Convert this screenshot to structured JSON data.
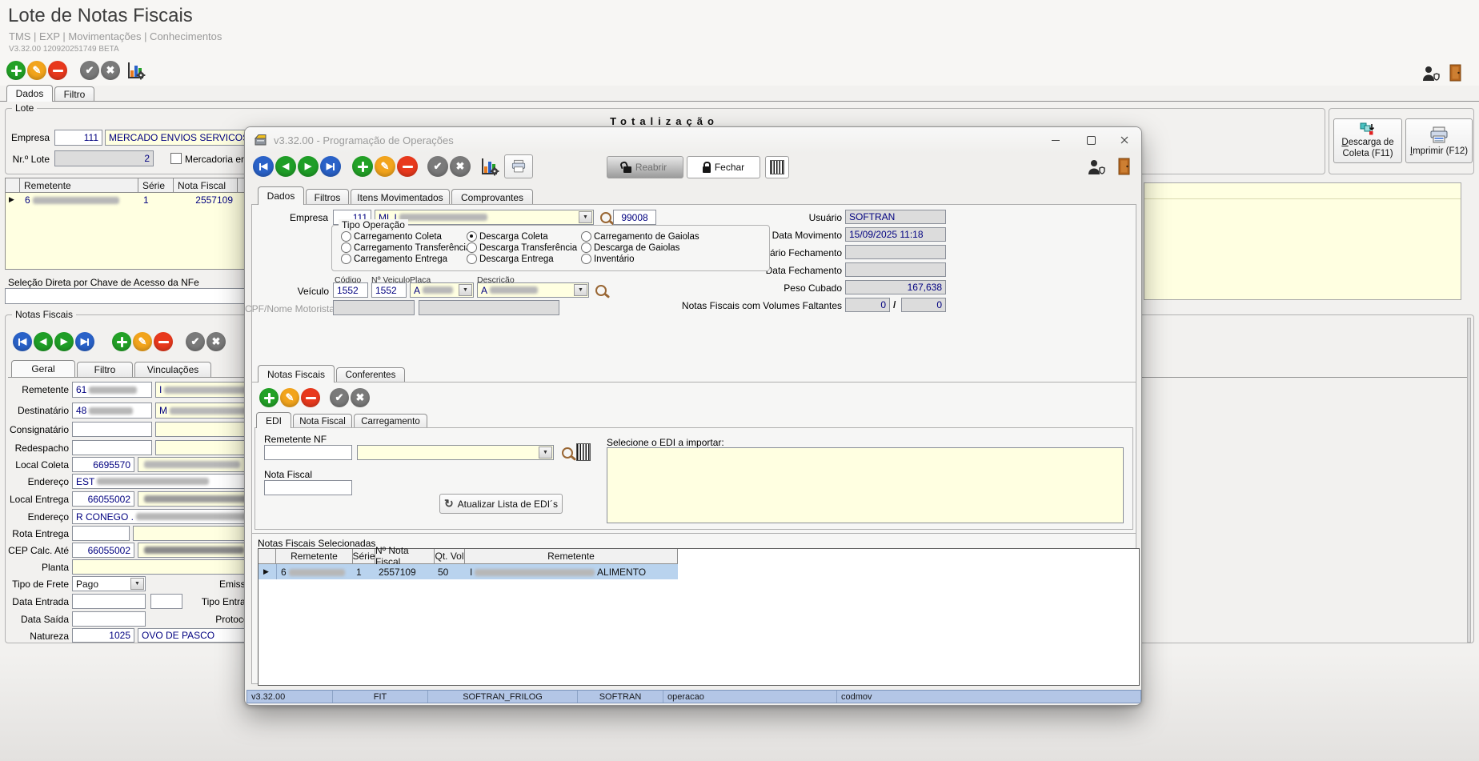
{
  "colors": {
    "accent_navy": "#000080",
    "field_yellow": "#ffffe1",
    "status_blue": "#b3c6e6",
    "green": "#23a127",
    "orange": "#f2a41c",
    "red": "#e8391d",
    "gray": "#7a7a7a",
    "blue": "#2a62c8"
  },
  "icons": {
    "pencil": "✎",
    "check": "✔",
    "cross": "✖",
    "prev": "◀",
    "next": "▶",
    "dropdown": "▼",
    "refresh": "↻",
    "pointer": "▶"
  },
  "main": {
    "title": "Lote de Notas Fiscais",
    "breadcrumb": "TMS | EXP | Movimentações | Conhecimentos",
    "version": "V3.32.00 120920251749 BETA",
    "tabs": {
      "dados": "Dados",
      "filtro": "Filtro"
    },
    "lote": {
      "legend": "Lote",
      "totalizacao": "Totalização",
      "empresa_label": "Empresa",
      "empresa_code": "111",
      "empresa_name": "MERCADO ENVIOS SERVICOS DE LO",
      "nr_lote_label": "Nr.º Lote",
      "nr_lote_value": "2",
      "mercadoria_label": "Mercadoria entregue"
    },
    "grid": {
      "headers": {
        "remetente": "Remetente",
        "serie": "Série",
        "nota_fiscal": "Nota Fiscal"
      },
      "row": {
        "remetente_prefix": "6",
        "serie": "1",
        "nota_fiscal": "2557109"
      }
    },
    "chave_label": "Seleção Direta por Chave de Acesso da NFe",
    "notas": {
      "legend": "Notas Fiscais",
      "tabs": {
        "geral": "Geral",
        "filtro": "Filtro",
        "vinculacoes": "Vinculações"
      },
      "fields": {
        "remetente": {
          "label": "Remetente",
          "code": "61",
          "name_prefix": "I"
        },
        "destinatario": {
          "label": "Destinatário",
          "code": "48",
          "name_prefix": "M"
        },
        "consignatario": {
          "label": "Consignatário"
        },
        "redespacho": {
          "label": "Redespacho"
        },
        "local_coleta": {
          "label": "Local Coleta",
          "code": "6695570"
        },
        "endereco_coleta": {
          "label": "Endereço",
          "value": "EST"
        },
        "local_entrega": {
          "label": "Local Entrega",
          "code": "66055002"
        },
        "endereco_entrega": {
          "label": "Endereço",
          "value": "R CONEGO ."
        },
        "rota_entrega": {
          "label": "Rota Entrega"
        },
        "cep_calc": {
          "label": "CEP Calc. Até",
          "code": "66055002"
        },
        "planta": {
          "label": "Planta"
        },
        "tipo_frete": {
          "label": "Tipo de Frete",
          "value": "Pago"
        },
        "emissao": {
          "label": "Emissão"
        },
        "data_entrada": {
          "label": "Data Entrada"
        },
        "tipo_entrada": {
          "label": "Tipo Entrada"
        },
        "data_saida": {
          "label": "Data Saída"
        },
        "protocolo": {
          "label": "Protocolo"
        },
        "natureza": {
          "label": "Natureza",
          "code": "1025",
          "value": "OVO DE PASCO"
        }
      }
    },
    "actions": {
      "descarga": "Descarga de Coleta (F11)",
      "imprimir": "Imprimir (F12)"
    }
  },
  "modal": {
    "title": "v3.32.00 - Programação de Operações",
    "toolbar": {
      "reabrir": "Reabrir",
      "fechar": "Fechar"
    },
    "tabs": {
      "dados": "Dados",
      "filtros": "Filtros",
      "itens": "Itens Movimentados",
      "comprovantes": "Comprovantes"
    },
    "empresa": {
      "label": "Empresa",
      "code": "111",
      "name_prefix": "ML I",
      "code2": "99008"
    },
    "tipo_operacao": {
      "legend": "Tipo Operação",
      "options": [
        "Carregamento Coleta",
        "Carregamento Transferência",
        "Carregamento Entrega",
        "Descarga Coleta",
        "Descarga Transferência",
        "Descarga Entrega",
        "Carregamento de Gaiolas",
        "Descarga de Gaiolas",
        "Inventário"
      ],
      "selected": "Descarga Coleta"
    },
    "veiculo": {
      "label": "Veículo",
      "h_codigo": "Código",
      "h_nveiculo": "Nº Veiculo",
      "h_placa": "Placa",
      "h_descricao": "Descrição",
      "codigo": "1552",
      "n_veiculo": "1552",
      "placa_prefix": "A",
      "descricao_prefix": "A"
    },
    "cpf_label": "CPF/Nome Motorista",
    "info": {
      "usuario_label": "Usuário",
      "usuario": "SOFTRAN",
      "data_movimento_label": "Data Movimento",
      "data_movimento": "15/09/2025 11:18",
      "usuario_fechamento_label": "Usuário Fechamento",
      "data_fechamento_label": "Data Fechamento",
      "peso_cubado_label": "Peso Cubado",
      "peso_cubado": "167,638",
      "volumes_label": "Notas Fiscais com Volumes Faltantes",
      "volumes_a": "0",
      "volumes_sep": "/",
      "volumes_b": "0"
    },
    "panel": {
      "tabs": {
        "notas": "Notas Fiscais",
        "conferentes": "Conferentes"
      },
      "subtabs": {
        "edi": "EDI",
        "nota_fiscal": "Nota Fiscal",
        "carregamento": "Carregamento"
      },
      "edi": {
        "remetente_nf_label": "Remetente NF",
        "nota_fiscal_label": "Nota Fiscal",
        "atualizar_button": "Atualizar Lista de EDI´s",
        "selecione_label": "Selecione o EDI a importar:"
      }
    },
    "selecionadas": {
      "label": "Notas Fiscais Selecionadas",
      "headers": [
        "Remetente",
        "Série",
        "Nº Nota Fiscal",
        "Qt. Vol",
        "Remetente"
      ],
      "row": {
        "remetente_prefix": "6",
        "serie": "1",
        "nota_fiscal": "2557109",
        "qt_vol": "50",
        "remetente2_prefix": "I",
        "remetente2_suffix": "ALIMENTO"
      }
    },
    "statusbar": [
      "v3.32.00",
      "FIT",
      "SOFTRAN_FRILOG",
      "SOFTRAN",
      "operacao",
      "codmov"
    ]
  }
}
